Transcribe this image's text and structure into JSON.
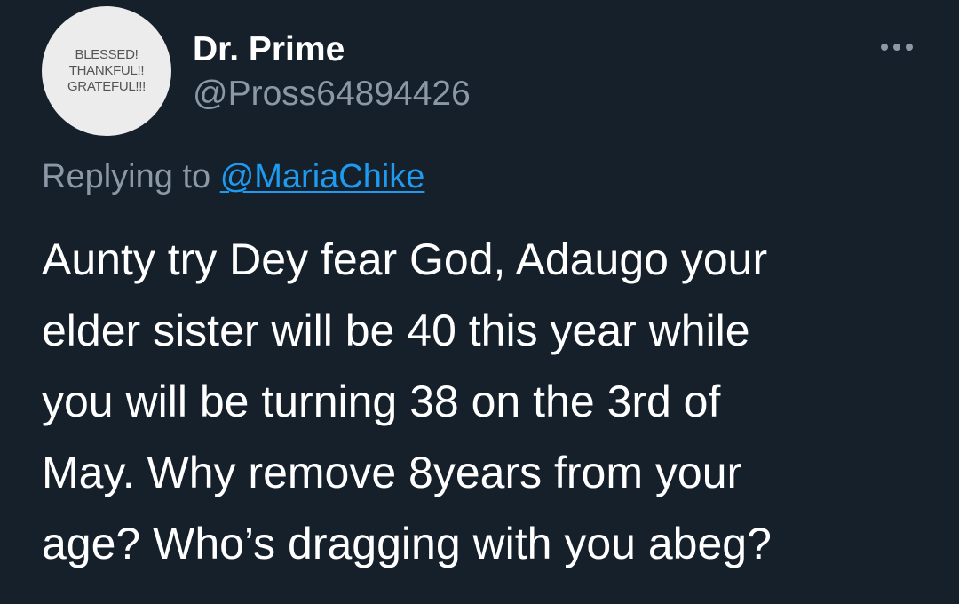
{
  "colors": {
    "background": "#15202b",
    "primary_text": "#ffffff",
    "secondary_text": "#8b98a5",
    "link": "#1d9bf0",
    "avatar_bg": "#ececec"
  },
  "author": {
    "avatar_lines": [
      "BLESSED!",
      "THANKFUL!!",
      "GRATEFUL!!!"
    ],
    "display_name": "Dr. Prime",
    "handle": "@Pross64894426"
  },
  "more_menu": {
    "icon": "more-horizontal-icon"
  },
  "reply_context": {
    "prefix": "Replying to",
    "target": "@MariaChike"
  },
  "tweet": {
    "lines": [
      "Aunty try Dey fear God, Adaugo your",
      "elder sister will be 40 this year while",
      "you will be turning 38 on the 3rd of",
      "May. Why remove 8years from your",
      "age? Who’s dragging with you abeg?"
    ]
  }
}
